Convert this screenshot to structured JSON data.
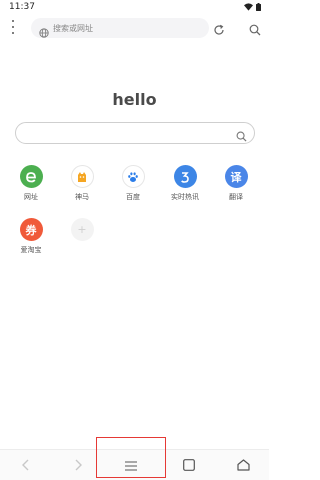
{
  "status_bar": {
    "time": "11:37"
  },
  "top_bar": {
    "url_placeholder": "搜索或网址",
    "icons": [
      "more-vert-icon",
      "globe-icon",
      "refresh-icon",
      "search-icon"
    ]
  },
  "home": {
    "title": "hello",
    "search": {
      "placeholder": ""
    }
  },
  "shortcuts": [
    {
      "label": "网址",
      "icon": "e",
      "color": "#4caf50"
    },
    {
      "label": "神马",
      "icon": "horse",
      "color": "#f5a623"
    },
    {
      "label": "百度",
      "icon": "paw",
      "color": "#2b7de9"
    },
    {
      "label": "实时热讯",
      "icon": "5",
      "color": "#3d86e6"
    },
    {
      "label": "翻译",
      "icon": "译",
      "color": "#4a86e8"
    },
    {
      "label": "爱淘宝",
      "icon": "券",
      "color": "#f05a3a"
    },
    {
      "label": "",
      "icon": "+",
      "color": "#e0e0e0"
    }
  ],
  "bottom_nav": {
    "items": [
      "back-icon",
      "forward-icon",
      "menu-icon",
      "tabs-icon",
      "home-icon"
    ]
  },
  "colors": {
    "highlight": "#e53935"
  }
}
